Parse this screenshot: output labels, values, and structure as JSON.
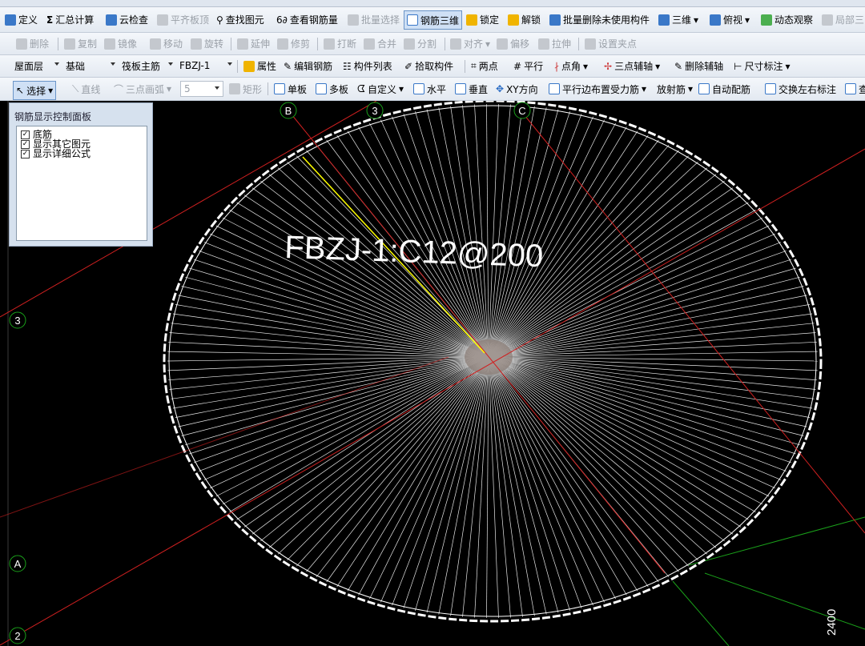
{
  "toolbar1": {
    "define": "定义",
    "sum_calc": "汇总计算",
    "cloud_check": "云检查",
    "flush_top": "平齐板顶",
    "find_element": "查找图元",
    "view_rebar_qty": "查看钢筋量",
    "batch_select": "批量选择",
    "rebar_3d": "钢筋三维",
    "lock": "锁定",
    "unlock": "解锁",
    "batch_delete_unused": "批量删除未使用构件",
    "view_3d": "三维",
    "top_view": "俯视",
    "dynamic_view": "动态观察",
    "local": "局部三"
  },
  "toolbar2": {
    "delete": "删除",
    "copy": "复制",
    "mirror": "镜像",
    "move": "移动",
    "rotate": "旋转",
    "extend": "延伸",
    "trim": "修剪",
    "break": "打断",
    "merge": "合并",
    "split": "分割",
    "align": "对齐",
    "offset": "偏移",
    "stretch": "拉伸",
    "set_grip": "设置夹点"
  },
  "toolbar3": {
    "floor": "屋面层",
    "category": "基础",
    "component_type": "筏板主筋",
    "component_name": "FBZJ-1",
    "properties": "属性",
    "edit_rebar": "编辑钢筋",
    "component_list": "构件列表",
    "pick_component": "拾取构件",
    "two_points": "两点",
    "parallel": "平行",
    "point_angle": "点角",
    "three_point_axis": "三点辅轴",
    "delete_aux_axis": "删除辅轴",
    "dimension": "尺寸标注"
  },
  "toolbar4": {
    "select": "选择",
    "line": "直线",
    "three_point_arc": "三点画弧",
    "arc_value": "5",
    "rectangle": "矩形",
    "single_board": "单板",
    "multi_board": "多板",
    "custom": "自定义",
    "horizontal": "水平",
    "vertical": "垂直",
    "xy_direction": "XY方向",
    "parallel_edge_rebar": "平行边布置受力筋",
    "radial_rebar": "放射筋",
    "auto_rebar": "自动配筋",
    "swap_labels": "交换左右标注",
    "check": "查"
  },
  "control_panel": {
    "title": "钢筋显示控制面板",
    "items": [
      {
        "label": "底筋",
        "checked": true
      },
      {
        "label": "显示其它图元",
        "checked": true
      },
      {
        "label": "显示详细公式",
        "checked": true
      }
    ]
  },
  "canvas": {
    "rebar_label": "FBZJ-1:C12@200",
    "axis_labels": {
      "B": "B",
      "three_top": "3",
      "C": "C",
      "three_left": "3",
      "A": "A",
      "two": "2"
    },
    "dimension_text": "2400",
    "colors": {
      "background": "#000000",
      "rebar": "#ffffff",
      "axis": "#d02020",
      "highlight": "#ffff00",
      "guide": "#1aa01a",
      "axis_marker": "#1aa01a"
    }
  }
}
